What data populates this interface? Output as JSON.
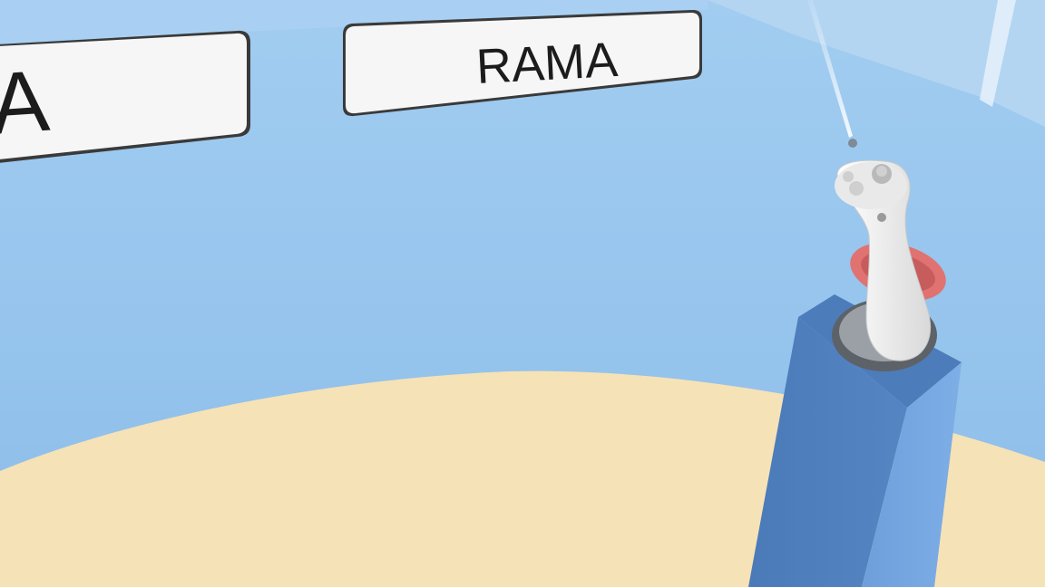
{
  "scene": {
    "wall_color": "#8fc1ec",
    "upper_wall_color": "#9ccaf0",
    "ceiling_color": "#c4ddf2",
    "floor_color": "#f6e2b7",
    "pedestal_color": "#4f7fbe"
  },
  "signs": [
    {
      "label": "A"
    },
    {
      "label": "RAMA"
    }
  ],
  "controller": {
    "body_color": "#f2f2f2",
    "ring_color": "#e07272",
    "buttons_color": "#d8d8d8"
  },
  "pointer_ray": {
    "color": "#ffffff"
  }
}
